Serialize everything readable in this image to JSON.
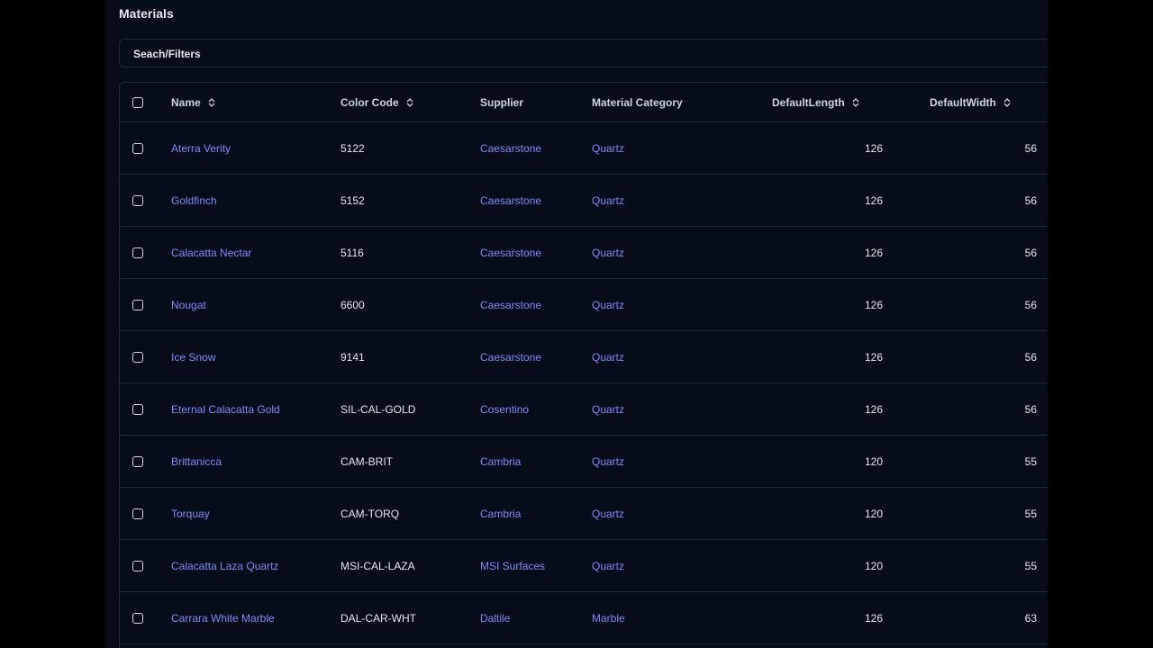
{
  "page": {
    "title": "Materials",
    "filters_label": "Seach/Filters"
  },
  "columns": {
    "name": "Name",
    "color_code": "Color Code",
    "supplier": "Supplier",
    "category": "Material Category",
    "default_length": "DefaultLength",
    "default_width": "DefaultWidth"
  },
  "rows": [
    {
      "name": "Aterra Verity",
      "color_code": "5122",
      "supplier": "Caesarstone",
      "category": "Quartz",
      "default_length": "126",
      "default_width": "56"
    },
    {
      "name": "Goldfinch",
      "color_code": "5152",
      "supplier": "Caesarstone",
      "category": "Quartz",
      "default_length": "126",
      "default_width": "56"
    },
    {
      "name": "Calacatta Nectar",
      "color_code": "5116",
      "supplier": "Caesarstone",
      "category": "Quartz",
      "default_length": "126",
      "default_width": "56"
    },
    {
      "name": "Nougat",
      "color_code": "6600",
      "supplier": "Caesarstone",
      "category": "Quartz",
      "default_length": "126",
      "default_width": "56"
    },
    {
      "name": "Ice Snow",
      "color_code": "9141",
      "supplier": "Caesarstone",
      "category": "Quartz",
      "default_length": "126",
      "default_width": "56"
    },
    {
      "name": "Eternal Calacatta Gold",
      "color_code": "SIL-CAL-GOLD",
      "supplier": "Cosentino",
      "category": "Quartz",
      "default_length": "126",
      "default_width": "56"
    },
    {
      "name": "Brittanicca",
      "color_code": "CAM-BRIT",
      "supplier": "Cambria",
      "category": "Quartz",
      "default_length": "120",
      "default_width": "55"
    },
    {
      "name": "Torquay",
      "color_code": "CAM-TORQ",
      "supplier": "Cambria",
      "category": "Quartz",
      "default_length": "120",
      "default_width": "55"
    },
    {
      "name": "Calacatta Laza Quartz",
      "color_code": "MSI-CAL-LAZA",
      "supplier": "MSI Surfaces",
      "category": "Quartz",
      "default_length": "120",
      "default_width": "55"
    },
    {
      "name": "Carrara White Marble",
      "color_code": "DAL-CAR-WHT",
      "supplier": "Daltile",
      "category": "Marble",
      "default_length": "126",
      "default_width": "63"
    }
  ],
  "icons": {
    "sort": "sort-icon",
    "checkbox": "checkbox-icon"
  },
  "colors": {
    "background": "#060c1a",
    "link": "#7c8cf8",
    "text": "#e5e7eb",
    "border": "#1f2937"
  }
}
